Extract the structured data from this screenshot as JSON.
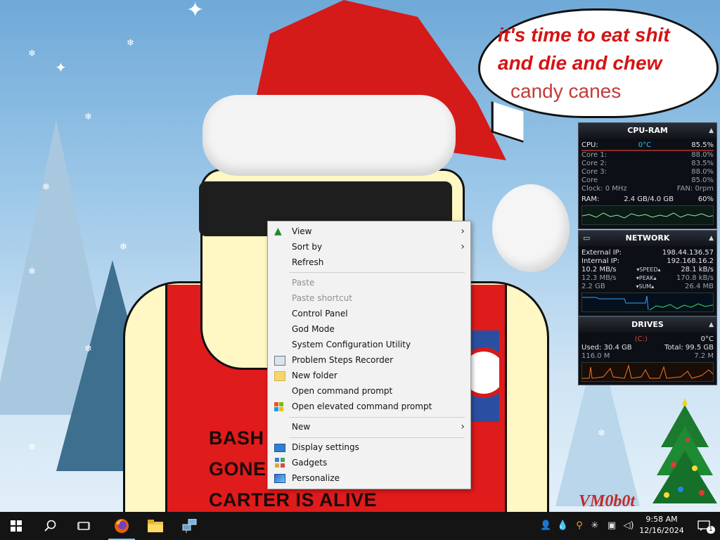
{
  "wallpaper": {
    "speech_bubble": {
      "line1": "it's time to eat shit",
      "line2": "and die and chew",
      "line3": "candy canes"
    },
    "shirt_text": {
      "line1": "BASH",
      "line2": "GONE",
      "line3": "CARTER IS ALIVE"
    },
    "signature": "VM0b0t"
  },
  "gadgets": {
    "cpu_ram": {
      "title": "CPU-RAM",
      "cpu_label": "CPU:",
      "cpu_temp": "0°C",
      "cpu_value": "85.5%",
      "cores": [
        {
          "label": "Core 1:",
          "value": "88.0%"
        },
        {
          "label": "Core 2:",
          "value": "83.5%"
        },
        {
          "label": "Core 3:",
          "value": "88.0%"
        },
        {
          "label": "Core",
          "value": "85.0%"
        }
      ],
      "clock": "Clock: 0 MHz",
      "fan": "FAN: 0rpm",
      "ram_label": "RAM:",
      "ram_usage": "2.4 GB/4.0 GB",
      "ram_percent": "60%"
    },
    "network": {
      "title": "NETWORK",
      "external_ip_label": "External IP:",
      "external_ip": "198.44.136.57",
      "internal_ip_label": "Internal IP:",
      "internal_ip": "192.168.16.2",
      "speed_down": "10.2 MB/s",
      "speed_label": "SPEED",
      "speed_up": "28.1 kB/s",
      "peak_down": "12.3 MB/s",
      "peak_label": "PEAK",
      "peak_up": "170.8 kB/s",
      "sum_down": "2.2 GB",
      "sum_label": "SUM",
      "sum_up": "26.4 MB"
    },
    "drives": {
      "title": "DRIVES",
      "drive_letter": "(C:)",
      "temp": "0°C",
      "used": "Used: 30.4 GB",
      "total": "Total: 99.5 GB",
      "read": "116.0 M",
      "write": "7.2 M"
    }
  },
  "context_menu": {
    "items": [
      {
        "label": "View",
        "submenu": true,
        "icon": "christmas-tree-icon"
      },
      {
        "label": "Sort by",
        "submenu": true
      },
      {
        "label": "Refresh"
      },
      {
        "label": "Paste",
        "disabled": true
      },
      {
        "label": "Paste shortcut",
        "disabled": true
      },
      {
        "label": "Control Panel"
      },
      {
        "label": "God Mode"
      },
      {
        "label": "System Configuration Utility"
      },
      {
        "label": "Problem Steps Recorder",
        "icon": "steps-recorder-icon"
      },
      {
        "label": "New folder",
        "icon": "folder-icon"
      },
      {
        "label": "Open command prompt"
      },
      {
        "label": "Open elevated command prompt",
        "icon": "windows-flag-icon"
      },
      {
        "label": "New",
        "submenu": true
      },
      {
        "label": "Display settings",
        "icon": "display-icon"
      },
      {
        "label": "Gadgets",
        "icon": "gadgets-icon"
      },
      {
        "label": "Personalize",
        "icon": "personalize-icon"
      }
    ]
  },
  "taskbar": {
    "time": "9:58 AM",
    "date": "12/16/2024",
    "notification_count": "1"
  },
  "colors": {
    "taskbar": "#141414",
    "menu_bg": "#f2f2f2",
    "gadget_bg": "#0c0f15",
    "accent_cyan": "#2ec4f1",
    "accent_red": "#e04343"
  }
}
